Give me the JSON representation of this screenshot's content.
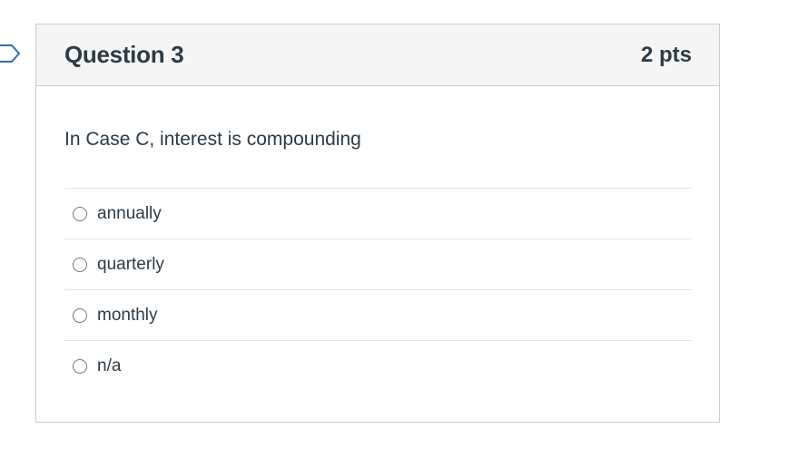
{
  "question": {
    "title": "Question 3",
    "points": "2 pts",
    "text": "In Case C, interest is compounding"
  },
  "answers": [
    {
      "label": "annually",
      "selected": false
    },
    {
      "label": "quarterly",
      "selected": false
    },
    {
      "label": "monthly",
      "selected": false
    },
    {
      "label": "n/a",
      "selected": false
    }
  ],
  "icons": {
    "flag": "flag-marker-icon",
    "radio": "radio-button-icon"
  },
  "colors": {
    "text": "#2d3b45",
    "header_bg": "#f5f5f5",
    "border": "#c7cdd1",
    "flag_stroke": "#2d6ea8"
  }
}
